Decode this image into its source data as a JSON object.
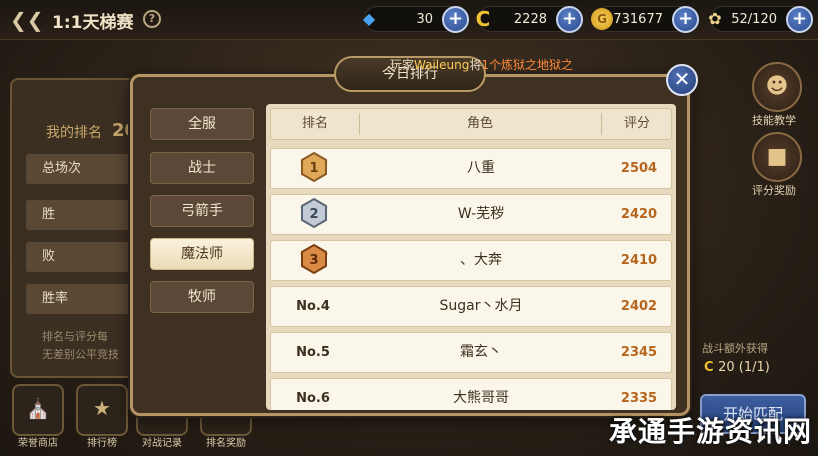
{
  "header": {
    "back_icon": "back-arrow-icon",
    "title": "1:1天梯赛",
    "help_icon": "question-icon"
  },
  "resources": [
    {
      "icon": "blue-diamond-icon",
      "value": "30",
      "color": "#4aa3f0"
    },
    {
      "icon": "gold-c-coin-icon",
      "value": "2228",
      "color": "#f1c232"
    },
    {
      "icon": "gold-coin-icon",
      "value": "731677",
      "color": "#f0b92e"
    },
    {
      "icon": "wings-icon",
      "value": "52/120",
      "color": "#e8cf8c"
    }
  ],
  "left_panel": {
    "my_rank_label": "我的排名",
    "my_rank_value": "20",
    "rows": [
      "总场次",
      "胜",
      "败",
      "胜率"
    ],
    "note_line1": "排名与评分每",
    "note_line2": "无差别公平竞技"
  },
  "bottom_nav": [
    {
      "label": "荣誉商店",
      "icon": "shop-icon"
    },
    {
      "label": "排行榜",
      "icon": "trophy-icon"
    },
    {
      "label": "对战记录",
      "icon": "crossed-swords-icon"
    },
    {
      "label": "排名奖励",
      "icon": "reward-icon"
    }
  ],
  "right_side": {
    "skill_label": "技能教学",
    "reward_label": "评分奖励",
    "extra_line1": "战斗额外获得",
    "extra_value": "20 (1/1)",
    "start_label": "开始匹配"
  },
  "modal": {
    "tab_label": "今日排行",
    "ticker_prefix": "玩家",
    "ticker_name": "Waileung",
    "ticker_mid": "将",
    "ticker_highlight": "1个炼狱之地狱之",
    "close_icon": "close-icon",
    "categories": [
      "全服",
      "战士",
      "弓箭手",
      "魔法师",
      "牧师"
    ],
    "active_category": "魔法师",
    "columns": [
      "排名",
      "角色",
      "评分"
    ],
    "rows": [
      {
        "rank": "1",
        "medal": "gold",
        "role": "八重",
        "score": "2504"
      },
      {
        "rank": "2",
        "medal": "silver",
        "role": "W-芜秽",
        "score": "2420"
      },
      {
        "rank": "3",
        "medal": "bronze",
        "role": "、大奔",
        "score": "2410"
      },
      {
        "rank": "No.4",
        "medal": "",
        "role": "Sugar丶水月",
        "score": "2402"
      },
      {
        "rank": "No.5",
        "medal": "",
        "role": "霜玄丶",
        "score": "2345"
      },
      {
        "rank": "No.6",
        "medal": "",
        "role": "大熊哥哥",
        "score": "2335"
      }
    ]
  },
  "watermark": "承通手游资讯网"
}
